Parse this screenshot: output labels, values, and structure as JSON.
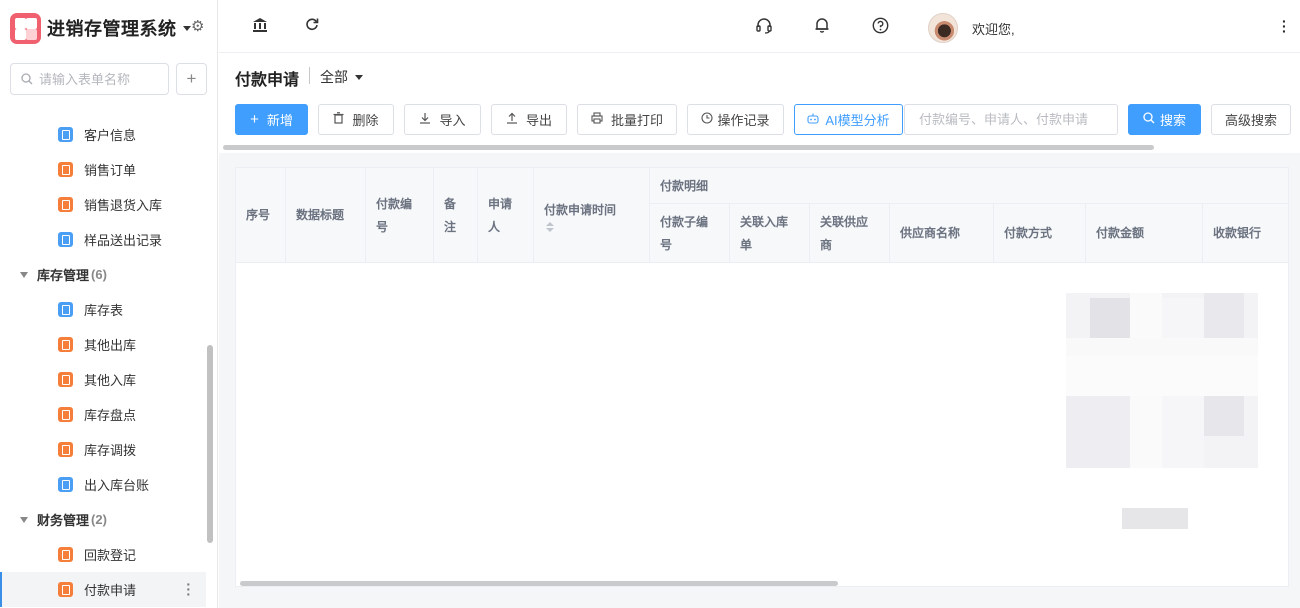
{
  "app": {
    "title": "进销存管理系统",
    "search_placeholder": "请输入表单名称"
  },
  "sidebar": {
    "items": [
      {
        "label": "客户信息",
        "icon": "form-icon",
        "color": "blue"
      },
      {
        "label": "销售订单",
        "icon": "form-icon",
        "color": "orange"
      },
      {
        "label": "销售退货入库",
        "icon": "form-icon",
        "color": "orange"
      },
      {
        "label": "样品送出记录",
        "icon": "form-icon",
        "color": "blue"
      }
    ],
    "groups": [
      {
        "name": "库存管理",
        "count": "(6)",
        "items": [
          {
            "label": "库存表",
            "color": "blue"
          },
          {
            "label": "其他出库",
            "color": "orange"
          },
          {
            "label": "其他入库",
            "color": "orange"
          },
          {
            "label": "库存盘点",
            "color": "orange"
          },
          {
            "label": "库存调拨",
            "color": "orange"
          },
          {
            "label": "出入库台账",
            "color": "blue"
          }
        ]
      },
      {
        "name": "财务管理",
        "count": "(2)",
        "items": [
          {
            "label": "回款登记",
            "color": "orange"
          },
          {
            "label": "付款申请",
            "color": "orange",
            "active": true
          }
        ]
      }
    ]
  },
  "topbar": {
    "welcome": "欢迎您,",
    "icons": [
      "bank-icon",
      "refresh-icon",
      "headset-icon",
      "bell-icon",
      "help-icon"
    ]
  },
  "page": {
    "title": "付款申请",
    "view": "全部"
  },
  "toolbar": {
    "add": "新增",
    "delete": "删除",
    "import": "导入",
    "export": "导出",
    "batch_print": "批量打印",
    "op_log": "操作记录",
    "ai": "AI模型分析",
    "search_placeholder": "付款编号、申请人、付款申请",
    "search": "搜索",
    "advanced": "高级搜索"
  },
  "table": {
    "headers": {
      "seq": "序号",
      "data_title": "数据标题",
      "pay_no_1": "付款编",
      "pay_no_2": "号",
      "remark_1": "备",
      "remark_2": "注",
      "applicant_1": "申请",
      "applicant_2": "人",
      "apply_time": "付款申请时间",
      "detail_group": "付款明细",
      "sub_no_1": "付款子编",
      "sub_no_2": "号",
      "inbound_1": "关联入库",
      "inbound_2": "单",
      "supplier_1": "关联供应",
      "supplier_2": "商",
      "supplier_name": "供应商名称",
      "pay_method": "付款方式",
      "amount": "付款金额",
      "bank": "收款银行"
    },
    "rows": []
  },
  "colors": {
    "primary": "#409eff",
    "icon_blue": "#4a9ff5",
    "icon_orange": "#f57f3a",
    "logo": "#f0606f"
  }
}
